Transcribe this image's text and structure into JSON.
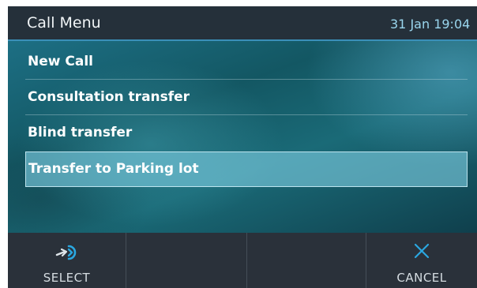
{
  "header": {
    "title": "Call Menu",
    "datetime": "31 Jan 19:04"
  },
  "menu": {
    "items": [
      {
        "label": "New Call"
      },
      {
        "label": "Consultation transfer"
      },
      {
        "label": "Blind transfer"
      },
      {
        "label": "Transfer to Parking lot",
        "selected": true
      }
    ]
  },
  "softkeys": [
    {
      "label": "SELECT",
      "icon": "select-arrow-icon"
    },
    {
      "label": ""
    },
    {
      "label": ""
    },
    {
      "label": "CANCEL",
      "icon": "close-x-icon"
    }
  ],
  "colors": {
    "header_bg": "#25303a",
    "accent": "#3a8fb8",
    "softkey_bg": "#2a313a",
    "selection": "#78c8dc"
  }
}
